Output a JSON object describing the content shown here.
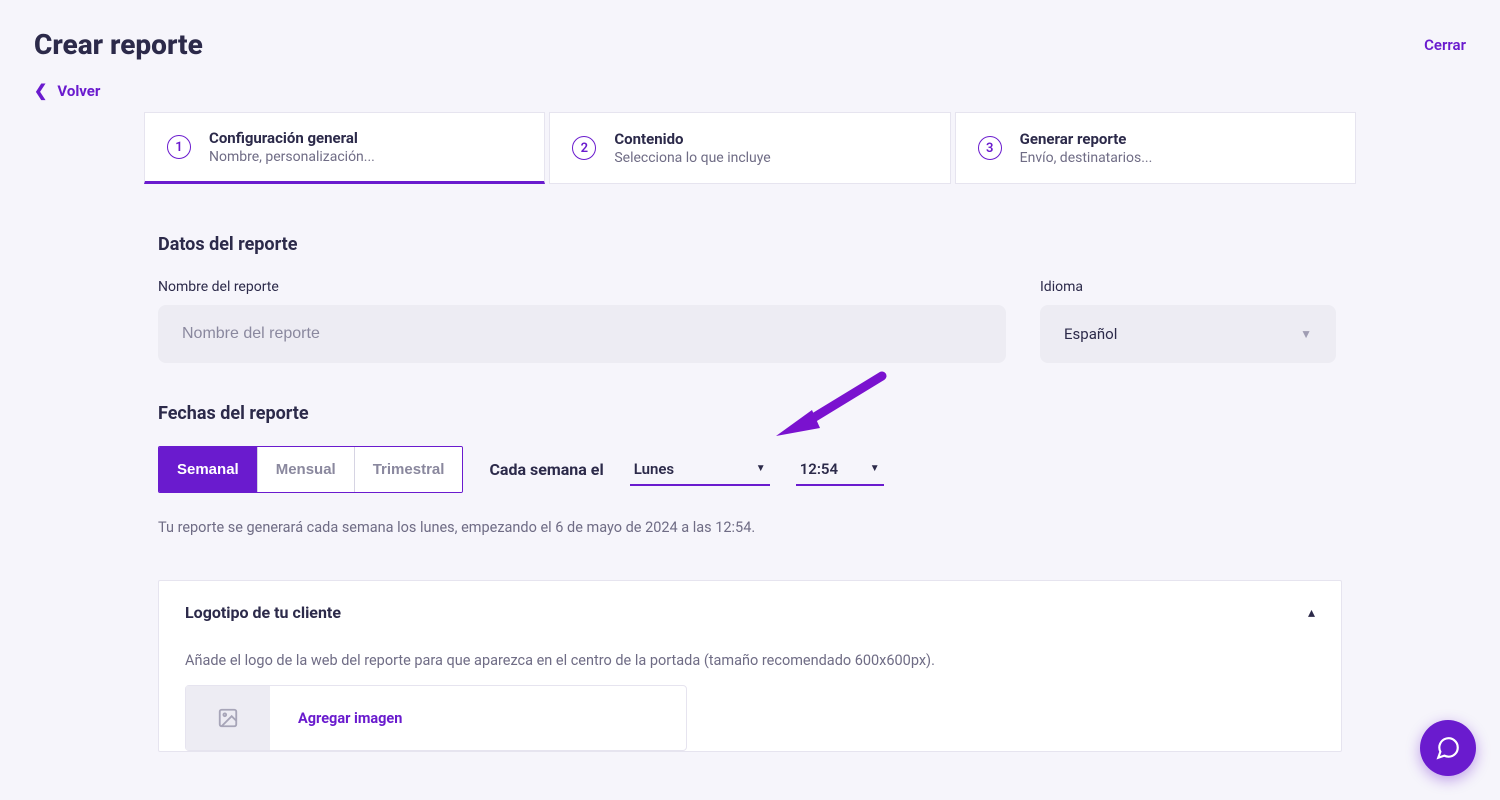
{
  "header": {
    "title": "Crear reporte",
    "close": "Cerrar",
    "back": "Volver"
  },
  "steps": [
    {
      "num": "1",
      "title": "Configuración general",
      "sub": "Nombre, personalización..."
    },
    {
      "num": "2",
      "title": "Contenido",
      "sub": "Selecciona lo que incluye"
    },
    {
      "num": "3",
      "title": "Generar reporte",
      "sub": "Envío, destinatarios..."
    }
  ],
  "report_data": {
    "section_title": "Datos del reporte",
    "name_label": "Nombre del reporte",
    "name_placeholder": "Nombre del reporte",
    "lang_label": "Idioma",
    "lang_value": "Español"
  },
  "dates": {
    "section_title": "Fechas del reporte",
    "options": {
      "weekly": "Semanal",
      "monthly": "Mensual",
      "quarterly": "Trimestral"
    },
    "every_label": "Cada semana el",
    "day_value": "Lunes",
    "time_value": "12:54",
    "helper": "Tu reporte se generará cada semana los lunes, empezando el 6 de mayo de 2024 a las 12:54."
  },
  "logo_panel": {
    "title": "Logotipo de tu cliente",
    "desc": "Añade el logo de la web del reporte para que aparezca en el centro de la portada (tamaño recomendado 600x600px).",
    "add_image": "Agregar imagen"
  }
}
